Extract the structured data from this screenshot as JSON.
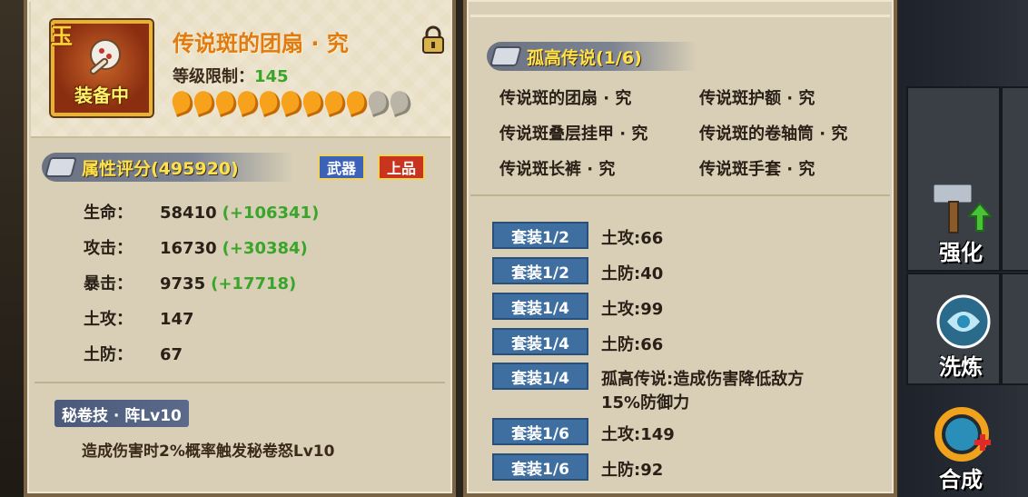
{
  "item": {
    "name": "传说斑的团扇 · 究",
    "equip_status": "装备中",
    "grade_glyph": "玉",
    "level_label": "等级限制：",
    "level_value": "145",
    "stars_filled": 9,
    "stars_total": 11
  },
  "attributes": {
    "title": "属性评分(495920)",
    "badges": [
      "武器",
      "上品"
    ],
    "stats": [
      {
        "label": "生命：",
        "value": "58410",
        "bonus": "(+106341)"
      },
      {
        "label": "攻击：",
        "value": "16730",
        "bonus": "(+30384)"
      },
      {
        "label": "暴击：",
        "value": "9735",
        "bonus": "(+17718)"
      },
      {
        "label": "土攻：",
        "value": "147",
        "bonus": ""
      },
      {
        "label": "土防：",
        "value": "67",
        "bonus": ""
      }
    ]
  },
  "skill": {
    "title": "秘卷技 · 阵Lv10",
    "description": "造成伤害时2%概率触发秘卷怒Lv10"
  },
  "set": {
    "title": "孤高传说(1/6)",
    "pieces": [
      "传说斑的团扇 · 究",
      "传说斑护额 · 究",
      "传说斑叠层挂甲 · 究",
      "传说斑的卷轴筒 · 究",
      "传说斑长裤 · 究",
      "传说斑手套 · 究"
    ],
    "bonuses": [
      {
        "tag": "套装1/2",
        "text": "土攻:66"
      },
      {
        "tag": "套装1/2",
        "text": "土防:40"
      },
      {
        "tag": "套装1/4",
        "text": "土攻:99"
      },
      {
        "tag": "套装1/4",
        "text": "土防:66"
      },
      {
        "tag": "套装1/4",
        "text": "孤高传说:造成伤害降低敌方",
        "text2": "15%防御力"
      },
      {
        "tag": "套装1/6",
        "text": "土攻:149"
      },
      {
        "tag": "套装1/6",
        "text": "土防:92"
      }
    ]
  },
  "actions": {
    "enhance": "强化",
    "refine": "洗炼",
    "combine": "合成"
  }
}
